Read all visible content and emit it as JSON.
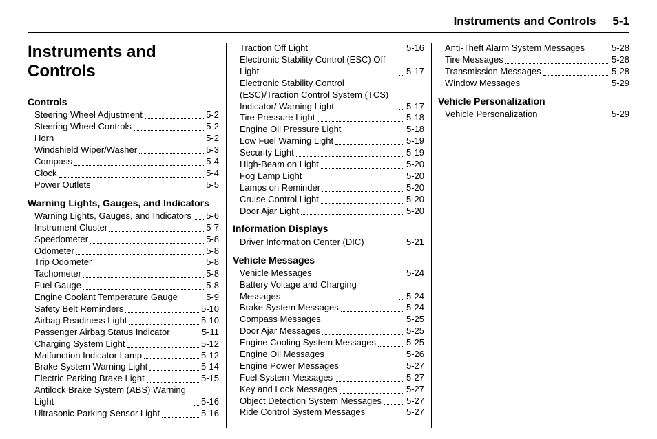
{
  "header": {
    "title": "Instruments and Controls",
    "page": "5-1"
  },
  "chapter_title": "Instruments and Controls",
  "sections": [
    {
      "heading": "Controls",
      "entries": [
        {
          "label": "Steering Wheel Adjustment",
          "page": "5-2"
        },
        {
          "label": "Steering Wheel Controls",
          "page": "5-2"
        },
        {
          "label": "Horn",
          "page": "5-2"
        },
        {
          "label": "Windshield Wiper/Washer",
          "page": "5-3"
        },
        {
          "label": "Compass",
          "page": "5-4"
        },
        {
          "label": "Clock",
          "page": "5-4"
        },
        {
          "label": "Power Outlets",
          "page": "5-5"
        }
      ]
    },
    {
      "heading": "Warning Lights, Gauges, and Indicators",
      "entries": [
        {
          "label": "Warning Lights, Gauges, and Indicators",
          "page": "5-6"
        },
        {
          "label": "Instrument Cluster",
          "page": "5-7"
        },
        {
          "label": "Speedometer",
          "page": "5-8"
        },
        {
          "label": "Odometer",
          "page": "5-8"
        },
        {
          "label": "Trip Odometer",
          "page": "5-8"
        },
        {
          "label": "Tachometer",
          "page": "5-8"
        },
        {
          "label": "Fuel Gauge",
          "page": "5-8"
        },
        {
          "label": "Engine Coolant Temperature Gauge",
          "page": "5-9"
        },
        {
          "label": "Safety Belt Reminders",
          "page": "5-10"
        },
        {
          "label": "Airbag Readiness Light",
          "page": "5-10"
        },
        {
          "label": "Passenger Airbag Status Indicator",
          "page": "5-11"
        },
        {
          "label": "Charging System Light",
          "page": "5-12"
        },
        {
          "label": "Malfunction Indicator Lamp",
          "page": "5-12"
        },
        {
          "label": "Brake System Warning Light",
          "page": "5-14"
        },
        {
          "label": "Electric Parking Brake Light",
          "page": "5-15"
        },
        {
          "label": "Antilock Brake System (ABS) Warning Light",
          "page": "5-16"
        },
        {
          "label": "Ultrasonic Parking Sensor Light",
          "page": "5-16"
        },
        {
          "label": "Traction Off Light",
          "page": "5-16"
        },
        {
          "label": "Electronic Stability Control (ESC) Off Light",
          "page": "5-17"
        },
        {
          "label": "Electronic Stability Control (ESC)/Traction Control System (TCS) Indicator/ Warning Light",
          "page": "5-17"
        },
        {
          "label": "Tire Pressure Light",
          "page": "5-18"
        },
        {
          "label": "Engine Oil Pressure Light",
          "page": "5-18"
        },
        {
          "label": "Low Fuel Warning Light",
          "page": "5-19"
        },
        {
          "label": "Security Light",
          "page": "5-19"
        },
        {
          "label": "High-Beam on Light",
          "page": "5-20"
        },
        {
          "label": "Fog Lamp Light",
          "page": "5-20"
        },
        {
          "label": "Lamps on Reminder",
          "page": "5-20"
        },
        {
          "label": "Cruise Control Light",
          "page": "5-20"
        },
        {
          "label": "Door Ajar Light",
          "page": "5-20"
        }
      ]
    },
    {
      "heading": "Information Displays",
      "entries": [
        {
          "label": "Driver Information Center (DIC)",
          "page": "5-21"
        }
      ]
    },
    {
      "heading": "Vehicle Messages",
      "entries": [
        {
          "label": "Vehicle Messages",
          "page": "5-24"
        },
        {
          "label": "Battery Voltage and Charging Messages",
          "page": "5-24"
        },
        {
          "label": "Brake System Messages",
          "page": "5-24"
        },
        {
          "label": "Compass Messages",
          "page": "5-25"
        },
        {
          "label": "Door Ajar Messages",
          "page": "5-25"
        },
        {
          "label": "Engine Cooling System Messages",
          "page": "5-25"
        },
        {
          "label": "Engine Oil Messages",
          "page": "5-26"
        },
        {
          "label": "Engine Power Messages",
          "page": "5-27"
        },
        {
          "label": "Fuel System Messages",
          "page": "5-27"
        },
        {
          "label": "Key and Lock Messages",
          "page": "5-27"
        },
        {
          "label": "Object Detection System Messages",
          "page": "5-27"
        },
        {
          "label": "Ride Control System Messages",
          "page": "5-27"
        },
        {
          "label": "Anti-Theft Alarm System Messages",
          "page": "5-28"
        },
        {
          "label": "Tire Messages",
          "page": "5-28"
        },
        {
          "label": "Transmission Messages",
          "page": "5-28"
        },
        {
          "label": "Window Messages",
          "page": "5-29"
        }
      ]
    },
    {
      "heading": "Vehicle Personalization",
      "entries": [
        {
          "label": "Vehicle Personalization",
          "page": "5-29"
        }
      ]
    }
  ]
}
